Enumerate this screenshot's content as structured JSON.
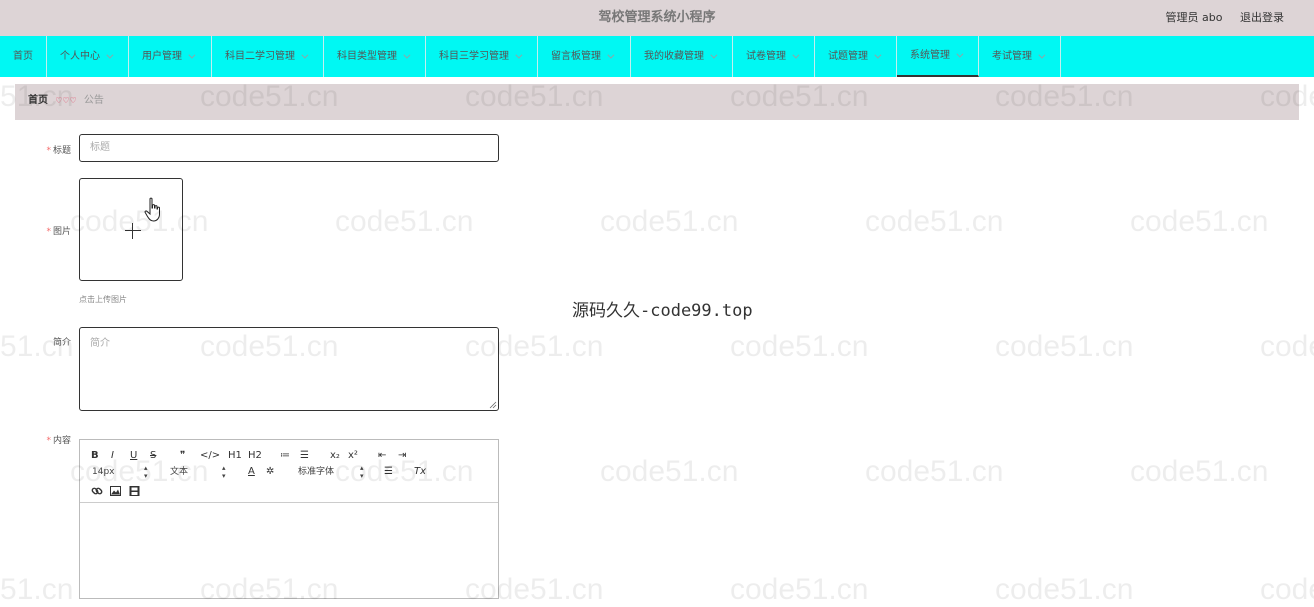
{
  "header": {
    "app_title": "驾校管理系统小程序",
    "user_label": "管理员 abo",
    "logout_label": "退出登录"
  },
  "nav": {
    "items": [
      {
        "label": "首页",
        "has_menu": false,
        "active": false
      },
      {
        "label": "个人中心",
        "has_menu": true,
        "active": false
      },
      {
        "label": "用户管理",
        "has_menu": true,
        "active": false
      },
      {
        "label": "科目二学习管理",
        "has_menu": true,
        "active": false
      },
      {
        "label": "科目类型管理",
        "has_menu": true,
        "active": false
      },
      {
        "label": "科目三学习管理",
        "has_menu": true,
        "active": false
      },
      {
        "label": "留言板管理",
        "has_menu": true,
        "active": false
      },
      {
        "label": "我的收藏管理",
        "has_menu": true,
        "active": false
      },
      {
        "label": "试卷管理",
        "has_menu": true,
        "active": false
      },
      {
        "label": "试题管理",
        "has_menu": true,
        "active": false
      },
      {
        "label": "系统管理",
        "has_menu": true,
        "active": true
      },
      {
        "label": "考试管理",
        "has_menu": true,
        "active": false
      }
    ]
  },
  "breadcrumb": {
    "home": "首页",
    "separator": "♡♡♡",
    "current": "公告"
  },
  "form": {
    "title_label": "标题",
    "title_placeholder": "标题",
    "image_label": "图片",
    "upload_hint": "点击上传图片",
    "intro_label": "简介",
    "intro_placeholder": "简介",
    "content_label": "内容",
    "required_mark": "*"
  },
  "editor": {
    "buttons_row1": [
      "B",
      "I",
      "U",
      "S",
      "❞",
      "</>",
      "H1",
      "H2",
      "≔",
      "☰",
      "x₂",
      "x²",
      "⇤",
      "⇥"
    ],
    "font_size": "14px",
    "block_type": "文本",
    "font_family": "标准字体",
    "text_color_glyph": "A",
    "clear_glyph": "Tx"
  },
  "watermark": {
    "center_text": "源码久久-code99.top",
    "tile_text": "code51.cn"
  }
}
